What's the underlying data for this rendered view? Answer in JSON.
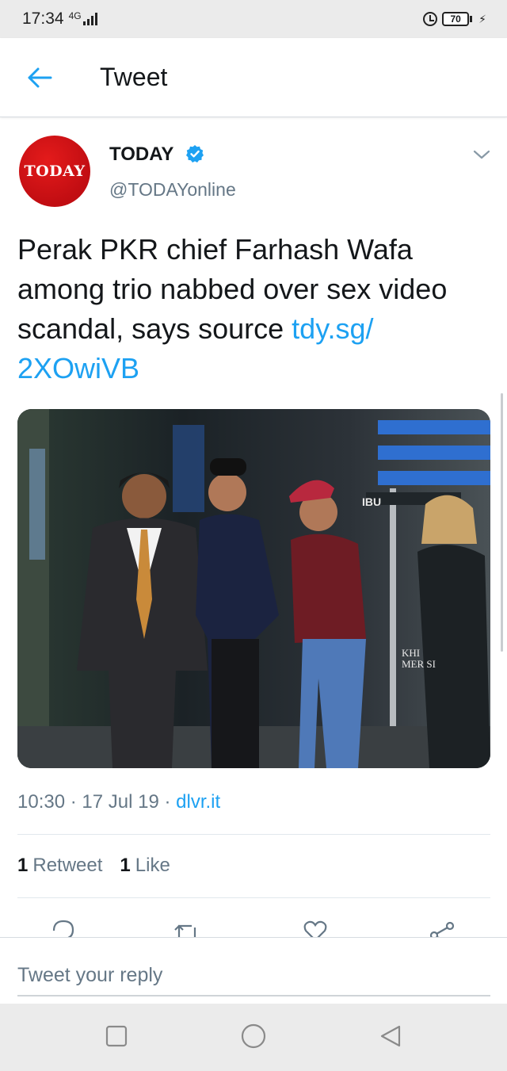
{
  "status_bar": {
    "time": "17:34",
    "network": "4G",
    "battery": "70",
    "icons": [
      "signal-icon",
      "alarm-icon",
      "battery-icon",
      "charging-icon"
    ]
  },
  "header": {
    "title": "Tweet",
    "back_icon": "arrow-left-icon",
    "accent_color": "#1da1f2"
  },
  "tweet": {
    "avatar_text": "TODAY",
    "author_name": "TODAY",
    "author_handle": "@TODAYonline",
    "verified": true,
    "text": "Perak PKR chief Farhash Wafa among trio nabbed over sex video scandal, says source ",
    "link_text": "tdy.sg/ 2XOwiVB",
    "time": "10:30",
    "date": "17 Jul 19",
    "source": "dlvr.it",
    "separator": "·",
    "retweet_count": "1",
    "retweet_label": "Retweet",
    "like_count": "1",
    "like_label": "Like"
  },
  "actions": [
    "reply-icon",
    "retweet-icon",
    "like-icon",
    "share-icon"
  ],
  "reply": {
    "placeholder": "Tweet your reply"
  },
  "nav": [
    "recents-icon",
    "home-icon",
    "back-icon"
  ]
}
